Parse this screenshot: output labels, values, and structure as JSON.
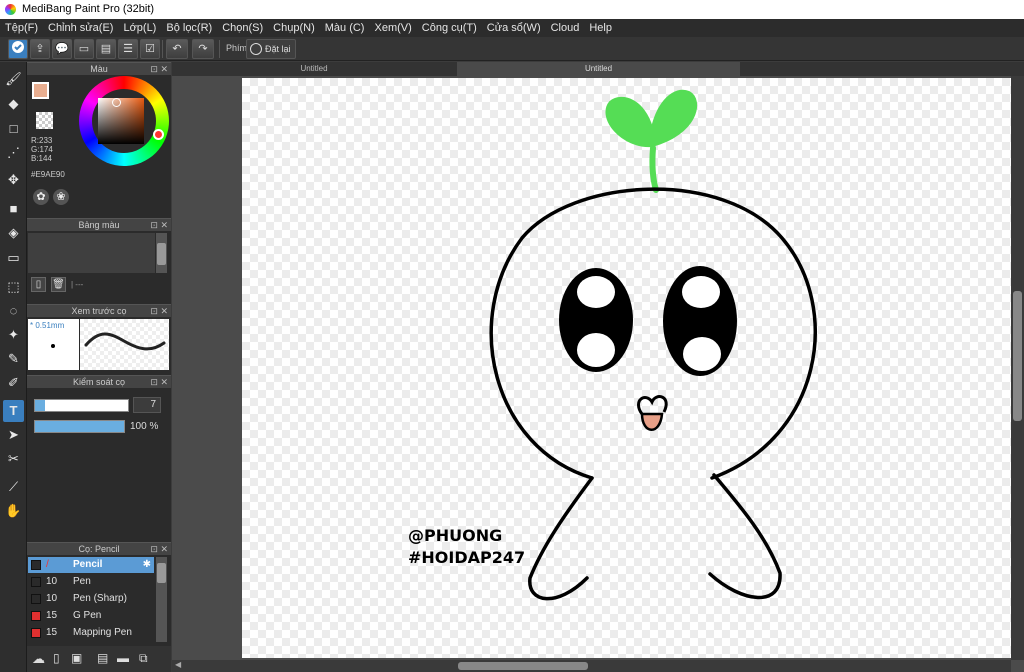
{
  "window": {
    "title": "MediBang Paint Pro (32bit)"
  },
  "menu": [
    "Tệp(F)",
    "Chỉnh sửa(E)",
    "Lớp(L)",
    "Bộ lọc(R)",
    "Chọn(S)",
    "Chụp(N)",
    "Màu (C)",
    "Xem(V)",
    "Công cụ(T)",
    "Cửa sổ(W)",
    "Cloud",
    "Help"
  ],
  "toolbar": {
    "phim_label": "Phím",
    "reset_label": "Đặt lại"
  },
  "color_panel": {
    "title": "Màu",
    "r": "R:233",
    "g": "G:174",
    "b": "B:144",
    "hex": "#E9AE90",
    "current_color": "#e9ae90"
  },
  "palette_panel": {
    "title": "Bảng màu",
    "status": "| ---"
  },
  "brush_preview": {
    "title": "Xem trước cọ",
    "size": "* 0.51mm"
  },
  "brush_control": {
    "title": "Kiểm soát cọ",
    "size_value": "7",
    "opacity_value": "100 %",
    "opacity": 1.0
  },
  "brush_list": {
    "title": "Cọ: Pencil",
    "items": [
      {
        "size": "/",
        "name": "Pencil",
        "color": "#2a2a2a",
        "selected": true
      },
      {
        "size": "10",
        "name": "Pen",
        "color": "#2a2a2a"
      },
      {
        "size": "10",
        "name": "Pen (Sharp)",
        "color": "#2a2a2a"
      },
      {
        "size": "15",
        "name": "G Pen",
        "color": "#e03030"
      },
      {
        "size": "15",
        "name": "Mapping Pen",
        "color": "#e03030"
      }
    ]
  },
  "tabs": [
    "Untitled",
    "Untitled"
  ],
  "canvas_text": {
    "line1": "@PHUONG",
    "line2": "#HOIDAP247"
  },
  "colors": {
    "sprout": "#55dd55",
    "tongue": "#e8a088",
    "selection": "#3a7fbf"
  }
}
